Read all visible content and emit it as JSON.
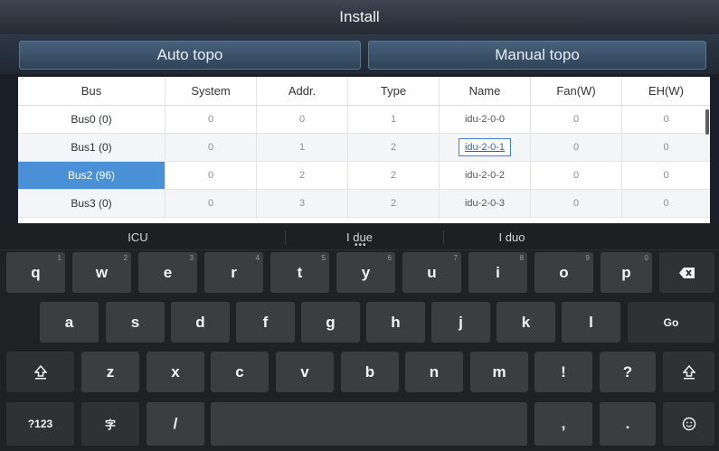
{
  "title": "Install",
  "tabs": {
    "auto": "Auto topo",
    "manual": "Manual topo"
  },
  "table": {
    "columns": [
      "Bus",
      "System",
      "Addr.",
      "Type",
      "Name",
      "Fan(W)",
      "EH(W)"
    ],
    "rows": [
      {
        "bus": "Bus0   (0)",
        "system": "0",
        "addr": "0",
        "type": "1",
        "name": "idu-2-0-0",
        "fan": "0",
        "eh": "0"
      },
      {
        "bus": "Bus1   (0)",
        "system": "0",
        "addr": "1",
        "type": "2",
        "name": "idu-2-0-1",
        "fan": "0",
        "eh": "0"
      },
      {
        "bus": "Bus2   (96)",
        "system": "0",
        "addr": "2",
        "type": "2",
        "name": "idu-2-0-2",
        "fan": "0",
        "eh": "0"
      },
      {
        "bus": "Bus3   (0)",
        "system": "0",
        "addr": "3",
        "type": "2",
        "name": "idu-2-0-3",
        "fan": "0",
        "eh": "0"
      }
    ],
    "selected_row": "Bus2   (96)",
    "editing_cell": "idu-2-0-1"
  },
  "keyboard": {
    "suggestions": [
      "ICU",
      "I due",
      "I duo"
    ],
    "row1": [
      {
        "label": "q",
        "hint": "1"
      },
      {
        "label": "w",
        "hint": "2"
      },
      {
        "label": "e",
        "hint": "3"
      },
      {
        "label": "r",
        "hint": "4"
      },
      {
        "label": "t",
        "hint": "5"
      },
      {
        "label": "y",
        "hint": "6"
      },
      {
        "label": "u",
        "hint": "7"
      },
      {
        "label": "i",
        "hint": "8"
      },
      {
        "label": "o",
        "hint": "9"
      },
      {
        "label": "p",
        "hint": "0"
      }
    ],
    "row2": [
      "a",
      "s",
      "d",
      "f",
      "g",
      "h",
      "j",
      "k",
      "l"
    ],
    "go": "Go",
    "row3": [
      "z",
      "x",
      "c",
      "v",
      "b",
      "n",
      "m",
      "!",
      "?"
    ],
    "row4": {
      "symbols": "?123",
      "lang": "字",
      "slash": "/",
      "comma": ",",
      "period": "."
    },
    "icons": {
      "backspace": "backspace-icon",
      "shift": "shift-icon",
      "emoji": "emoji-icon"
    }
  },
  "colors": {
    "selected": "#4a90d6",
    "edit_border": "#3d7fd0",
    "tab_fill": "#3d5570"
  }
}
